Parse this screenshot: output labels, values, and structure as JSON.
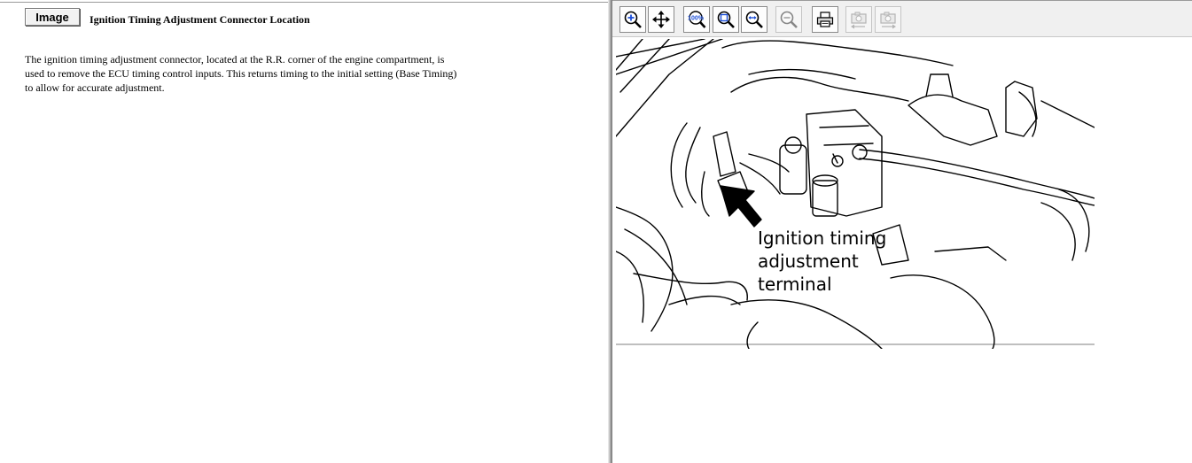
{
  "left_pane": {
    "image_button_label": "Image",
    "title": "Ignition Timing Adjustment Connector Location",
    "body": "The ignition timing adjustment connector, located at the R.R. corner of the engine compartment, is used to remove the ECU timing control inputs. This returns timing to the initial setting (Base Timing) to allow for accurate adjustment."
  },
  "toolbar": {
    "buttons": [
      {
        "id": "zoom-in",
        "icon": "zoom-in-icon",
        "state": "active"
      },
      {
        "id": "pan",
        "icon": "pan-arrows-icon",
        "state": "active"
      },
      {
        "id": "zoom-100",
        "icon": "zoom-100-percent-icon",
        "label": "100%",
        "state": "active"
      },
      {
        "id": "zoom-fit",
        "icon": "zoom-fit-icon",
        "state": "active"
      },
      {
        "id": "zoom-width",
        "icon": "zoom-width-icon",
        "state": "active"
      },
      {
        "id": "zoom-out",
        "icon": "zoom-out-icon",
        "state": "disabled"
      },
      {
        "id": "print",
        "icon": "printer-icon",
        "state": "active"
      },
      {
        "id": "prev-image",
        "icon": "camera-back-icon",
        "state": "disabled"
      },
      {
        "id": "next-image",
        "icon": "camera-forward-icon",
        "state": "disabled"
      }
    ]
  },
  "diagram": {
    "callout_lines": [
      "Ignition timing",
      "adjustment",
      "terminal"
    ]
  },
  "colors": {
    "accent_blue": "#1c4fd8",
    "toolbar_bg": "#f0f0f0"
  }
}
